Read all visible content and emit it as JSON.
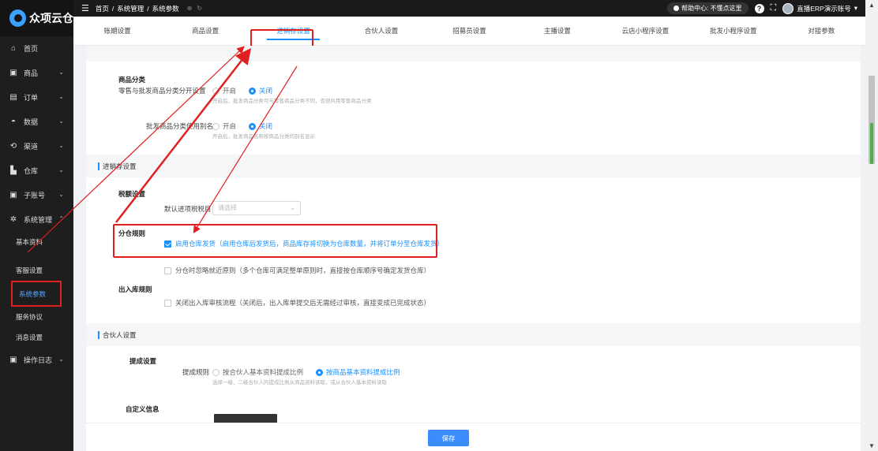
{
  "app": {
    "logo_text": "众项云仓"
  },
  "sidebar": {
    "items": [
      {
        "label": "首页",
        "icon": "home-icon",
        "glyph": "⌂"
      },
      {
        "label": "商品",
        "icon": "goods-icon",
        "glyph": "▣",
        "chev": "⌄"
      },
      {
        "label": "订单",
        "icon": "order-icon",
        "glyph": "▤",
        "chev": "⌄"
      },
      {
        "label": "数据",
        "icon": "data-icon",
        "glyph": "◓",
        "chev": "⌄"
      },
      {
        "label": "渠道",
        "icon": "channel-icon",
        "glyph": "⟲",
        "chev": "⌄"
      },
      {
        "label": "仓库",
        "icon": "warehouse-icon",
        "glyph": "▙",
        "chev": "⌄"
      },
      {
        "label": "子账号",
        "icon": "subaccount-icon",
        "glyph": "▣",
        "chev": "⌄"
      },
      {
        "label": "系统管理",
        "icon": "gear-icon",
        "glyph": "✲",
        "chev": "⌃"
      }
    ],
    "sub_items": [
      "基本资料",
      "客服设置",
      "系统参数",
      "服务协议",
      "消息设置"
    ],
    "last_item": {
      "label": "操作日志",
      "icon": "log-icon",
      "glyph": "▣",
      "chev": "⌄"
    }
  },
  "header": {
    "menu_glyph": "☰",
    "breadcrumb": [
      "首页",
      "系统管理",
      "系统参数"
    ],
    "breadcrumb_sep": "/",
    "help_label": "帮助中心: 不懂点这里",
    "help_glyph": "?",
    "fullscreen_glyph": "⛶",
    "account_label": "直播ERP演示账号",
    "account_chev": "▾"
  },
  "tabs": [
    "账期设置",
    "商品设置",
    "进销存设置",
    "合伙人设置",
    "招募员设置",
    "主播设置",
    "云店小程序设置",
    "批发小程序设置",
    "对接参数"
  ],
  "active_tab_index": 2,
  "product_category": {
    "title": "商品分类",
    "row1_label": "零售与批发商品分类分开设置",
    "row1_options": [
      "开启",
      "关闭"
    ],
    "row1_hint": "开启后，批发商品分类可与零售商品分类不同，否则共用零售商品分类",
    "row2_label": "批发商品分类使用别名",
    "row2_options": [
      "开启",
      "关闭"
    ],
    "row2_hint": "开启后，批发商品名称按商品分类的别名显示"
  },
  "inventory": {
    "section_title": "进销存设置",
    "tax_title": "税额设置",
    "tax_label": "默认进项税税目",
    "tax_placeholder": "请选择",
    "warehouse_title": "分仓规则",
    "warehouse_rule1": "启用仓库发货（启用仓库后发货后，商品库存将切换为仓库数量，并将订单分至仓库发货）",
    "warehouse_rule2": "分仓时忽略就近原则（多个仓库可满足整单原则时，直接按仓库顺序号确定发货仓库）",
    "inout_title": "出入库规则",
    "inout_rule": "关闭出入库审核流程（关闭后，出入库单提交后无需经过审核，直接变成已完成状态）"
  },
  "partner": {
    "section_title": "合伙人设置",
    "commission_title": "提成设置",
    "commission_label": "提成规则",
    "commission_options": [
      "按合伙人基本资料提成比例",
      "按商品基本资料提成比例"
    ],
    "commission_hint": "选择一级、二级合伙人的提成比例从商品资料读取，或从合伙人基本资料读取",
    "custom_title": "自定义信息"
  },
  "footer": {
    "save_label": "保存"
  },
  "colors": {
    "accent": "#1890ff",
    "annotation": "#e02020",
    "sidebar_bg": "#1e1e1e"
  }
}
